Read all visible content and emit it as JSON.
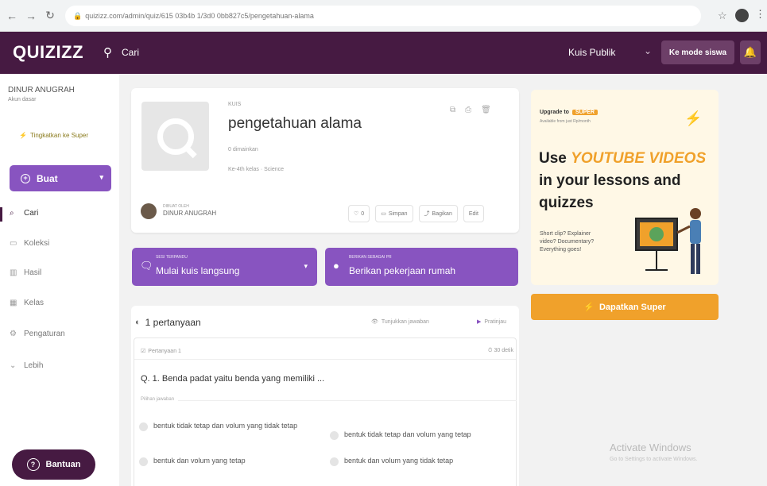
{
  "browser": {
    "url": "quizizz.com/admin/quiz/615 03b4b 1/3d0 0bb827c5/pengetahuan-alama"
  },
  "header": {
    "logo": "QUIZIZZ",
    "search_placeholder": "Cari",
    "kuis_publik": "Kuis Publik",
    "mode_button": "Ke mode siswa"
  },
  "sidebar": {
    "user_name": "DINUR ANUGRAH",
    "user_sub": "Akun dasar",
    "upgrade": "Tingkatkan ke Super",
    "create": "Buat",
    "items": [
      {
        "label": "Cari",
        "icon": "search-icon"
      },
      {
        "label": "Koleksi",
        "icon": "folder-icon"
      },
      {
        "label": "Hasil",
        "icon": "chart-icon"
      },
      {
        "label": "Kelas",
        "icon": "class-icon"
      },
      {
        "label": "Pengaturan",
        "icon": "gear-icon"
      },
      {
        "label": "Lebih",
        "icon": "chevron-down-icon"
      }
    ],
    "help": "Bantuan"
  },
  "quiz": {
    "type": "KUIS",
    "title": "pengetahuan alama",
    "played": "0 dimainkan",
    "meta": "Ke-4th kelas · Science",
    "author_label": "DIBUAT OLEH",
    "author": "DINUR ANUGRAH",
    "like_count": "0",
    "save": "Simpan",
    "share": "Bagikan",
    "edit": "Edit"
  },
  "actions": {
    "live_sub": "SESI TERPANDU",
    "live": "Mulai kuis langsung",
    "homework_sub": "BERIKAN SEBAGAI PR",
    "homework": "Berikan pekerjaan rumah"
  },
  "questions": {
    "count": "1 pertanyaan",
    "show_answers": "Tunjukkan jawaban",
    "preview": "Pratinjau",
    "q_number": "Pertanyaan 1",
    "time": "30 detik",
    "text": "Q. 1. Benda padat yaitu benda yang memiliki ...",
    "answer_label": "Pilihan jawaban",
    "options": [
      "bentuk tidak tetap dan volum yang tidak tetap",
      "bentuk tidak tetap dan volum yang tetap",
      "bentuk dan volum yang tetap",
      "bentuk dan volum yang tidak tetap"
    ]
  },
  "promo": {
    "upgrade": "Upgrade to",
    "super_badge": "SUPER",
    "sub": "Available from just Rp/month",
    "headline_pre": "Use ",
    "headline_hl": "YOUTUBE VIDEOS",
    "headline_post": " in your lessons and quizzes",
    "desc": "Short clip? Explainer video? Documentary? Everything goes!",
    "cta": "Dapatkan Super"
  },
  "watermark": {
    "title": "Activate Windows",
    "sub": "Go to Settings to activate Windows."
  },
  "colors": {
    "header": "#461a42",
    "primary": "#8854c0",
    "accent": "#f0a12b"
  }
}
